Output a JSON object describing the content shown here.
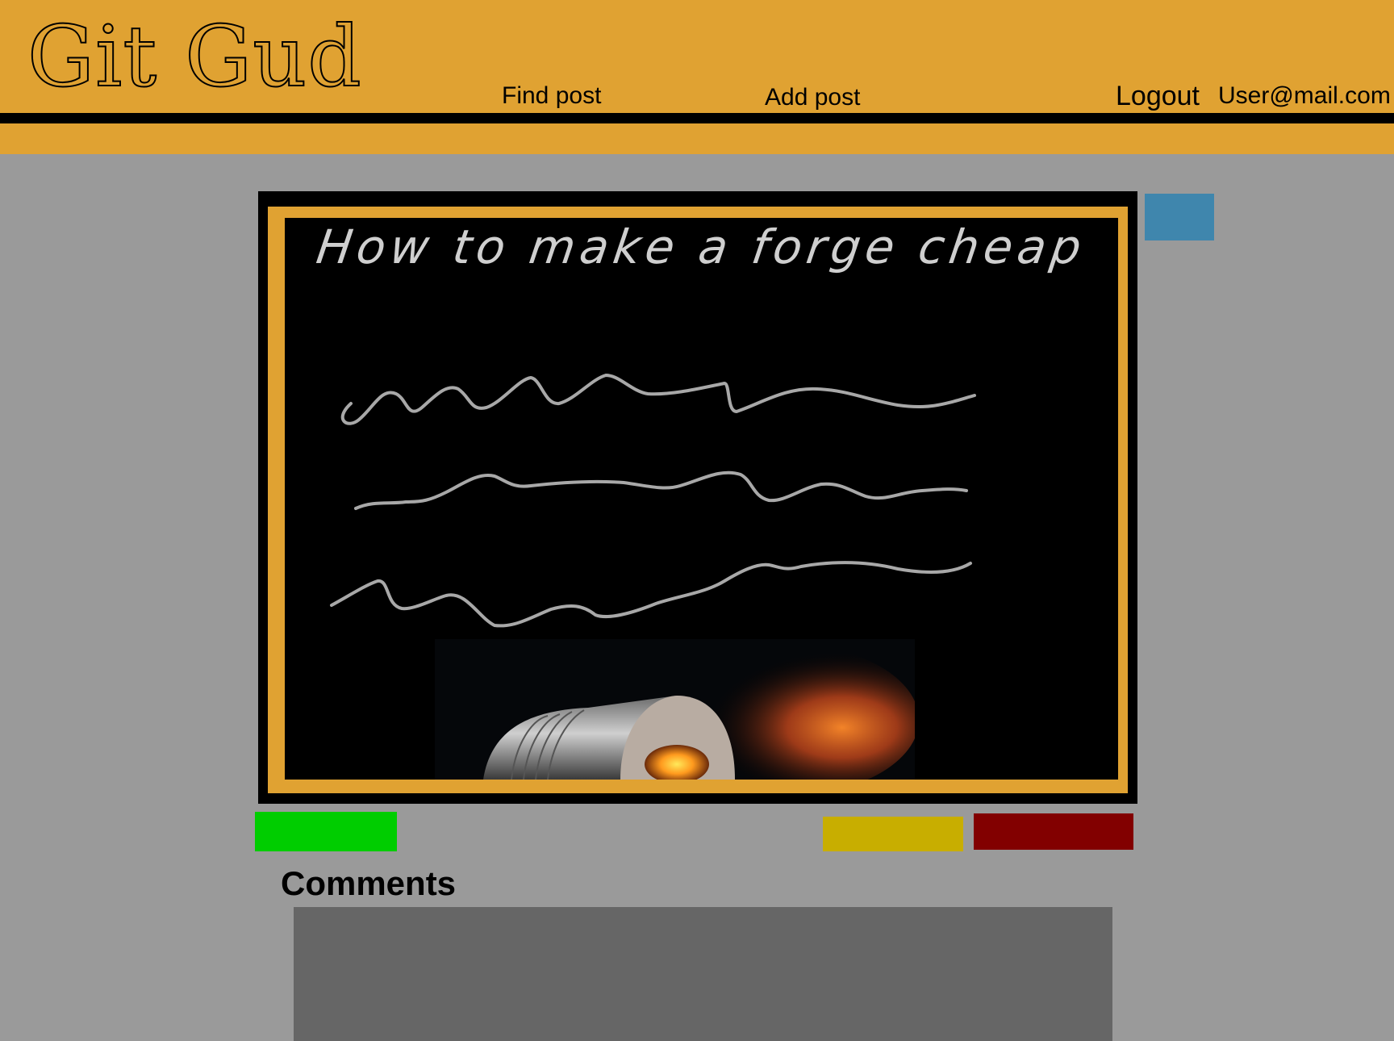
{
  "header": {
    "logo": "Git Gud",
    "nav": {
      "find_post": "Find post",
      "add_post": "Add post",
      "logout": "Logout",
      "user_email": "User@mail.com"
    }
  },
  "post": {
    "title": "How to make a forge cheap"
  },
  "comments": {
    "heading": "Comments"
  },
  "colors": {
    "brand": "#e0a232",
    "background": "#9a9a9a",
    "side_button": "#3f86ad",
    "green_button": "#00cd00",
    "yellow_button": "#c8ae00",
    "red_button": "#820000",
    "comments_box": "#666666"
  }
}
